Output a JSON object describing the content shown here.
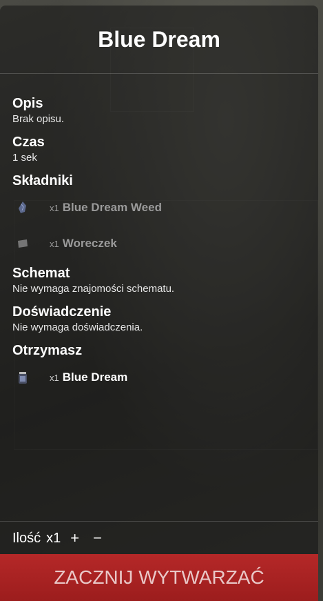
{
  "title": "Blue Dream",
  "sections": {
    "opis": {
      "heading": "Opis",
      "text": "Brak opisu."
    },
    "czas": {
      "heading": "Czas",
      "text": "1 sek"
    },
    "skladniki": {
      "heading": "Składniki",
      "items": [
        {
          "qty": "x1",
          "name": "Blue Dream Weed",
          "icon": "weed-icon"
        },
        {
          "qty": "x1",
          "name": "Woreczek",
          "icon": "bag-icon"
        }
      ]
    },
    "schemat": {
      "heading": "Schemat",
      "text": "Nie wymaga znajomości schematu."
    },
    "doswiadczenie": {
      "heading": "Doświadczenie",
      "text": "Nie wymaga doświadczenia."
    },
    "otrzymasz": {
      "heading": "Otrzymasz",
      "items": [
        {
          "qty": "x1",
          "name": "Blue Dream",
          "icon": "jar-icon"
        }
      ]
    }
  },
  "footer": {
    "quantity_label": "Ilość",
    "quantity_value": "x1",
    "plus": "+",
    "minus": "−"
  },
  "start_button": "ZACZNIJ WYTWARZAĆ",
  "colors": {
    "accent": "#b52828"
  }
}
